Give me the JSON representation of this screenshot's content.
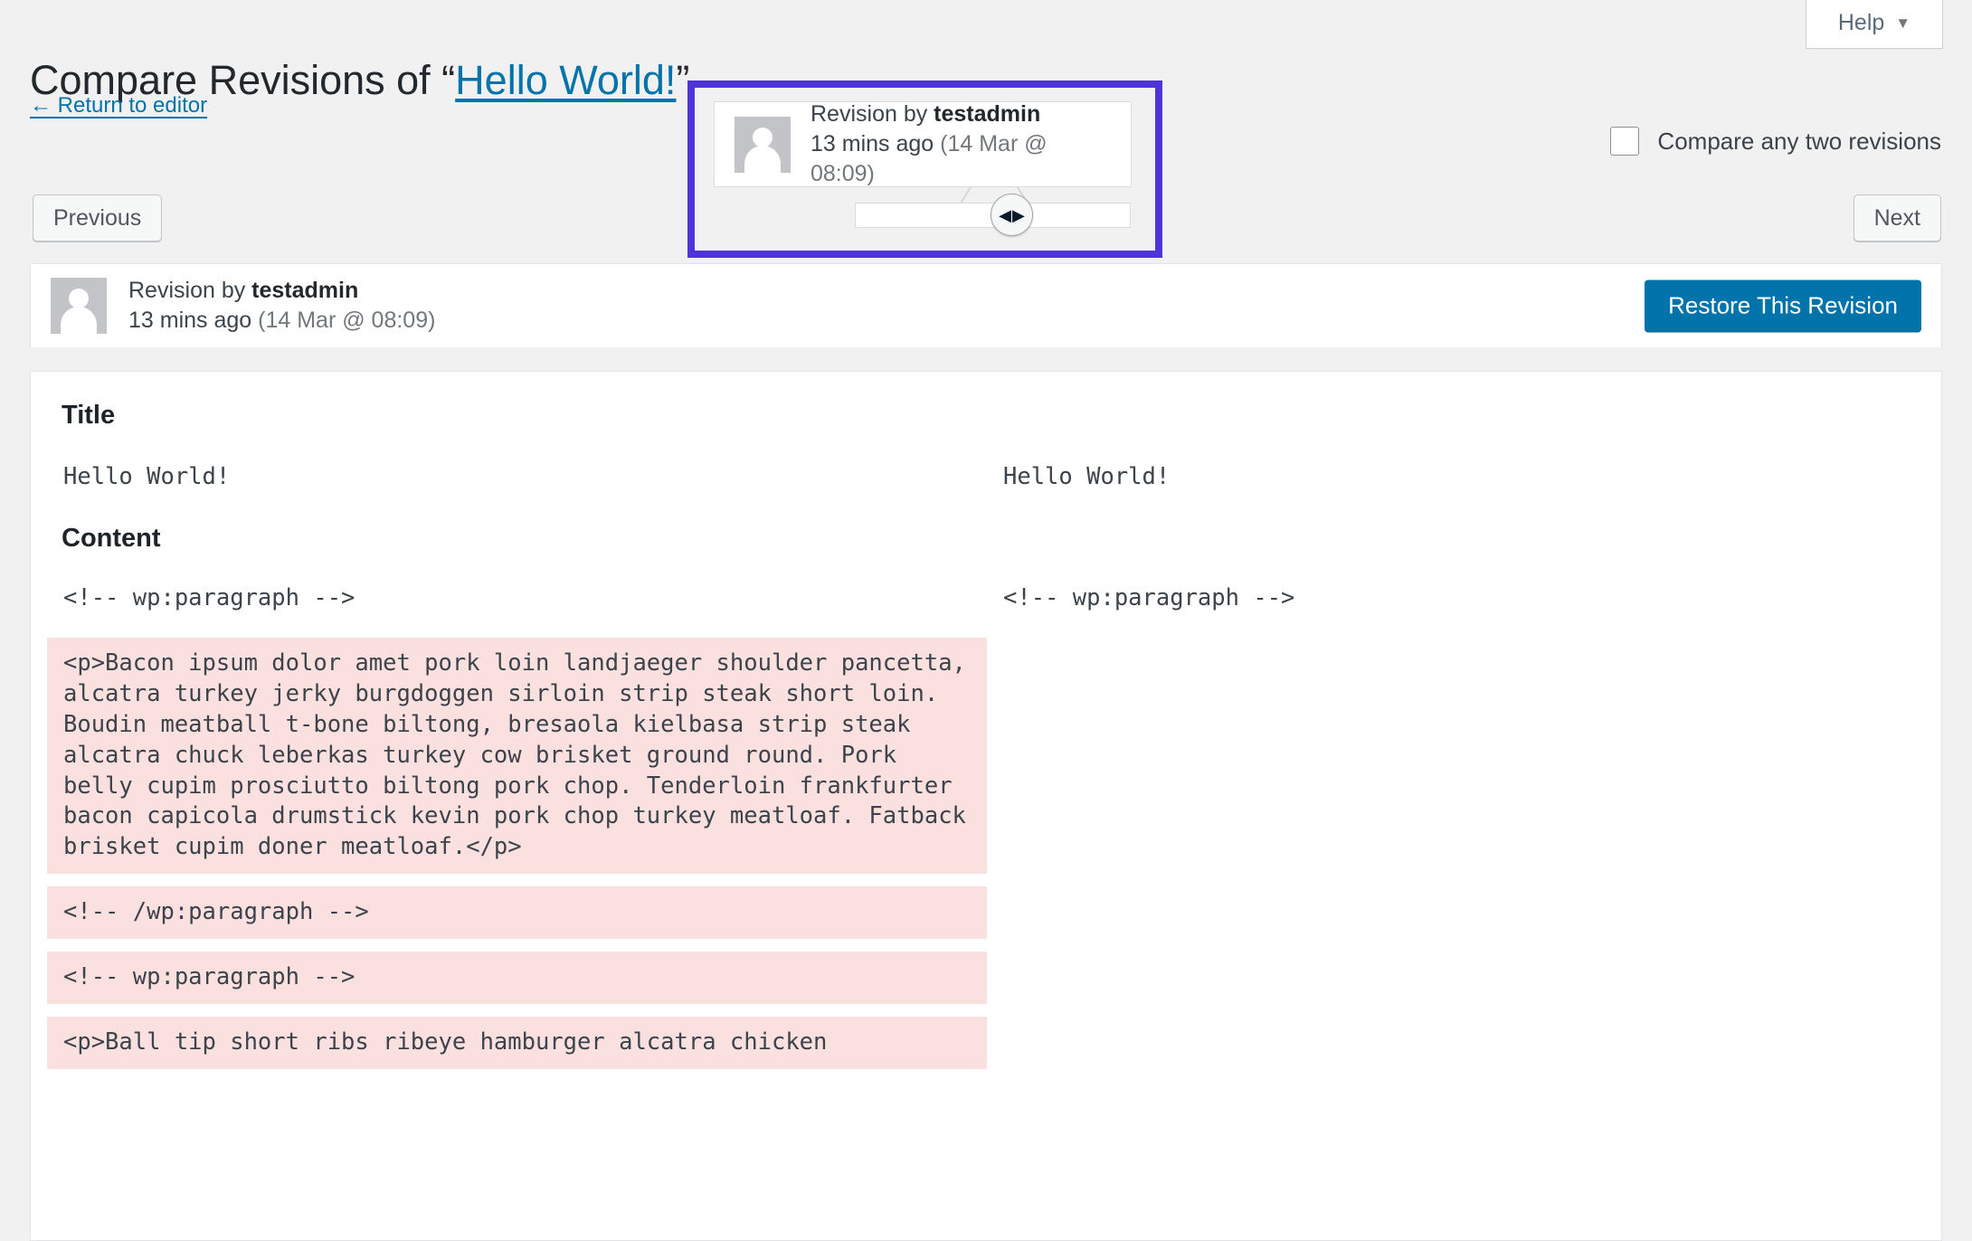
{
  "help": {
    "label": "Help",
    "caret": "▼",
    "icon": "chevron-down-icon"
  },
  "header": {
    "title_prefix": "Compare Revisions of “",
    "title_link": "Hello World!",
    "title_suffix": "”",
    "return_link": "← Return to editor"
  },
  "controls": {
    "previous": "Previous",
    "next": "Next",
    "compare_any_two": "Compare any two revisions",
    "compare_checked": false
  },
  "tooltip": {
    "revision_by_prefix": "Revision by ",
    "author": "testadmin",
    "relative_time": "13 mins ago",
    "absolute_time": " (14 Mar @ 08:09)",
    "avatar": "user-avatar-placeholder",
    "slider_handle_icon": "left-right-arrows-icon"
  },
  "revision_bar": {
    "revision_by_prefix": "Revision by ",
    "author": "testadmin",
    "relative_time": "13 mins ago",
    "absolute_time": " (14 Mar @ 08:09)",
    "restore_label": "Restore This Revision"
  },
  "diff": {
    "title_heading": "Title",
    "content_heading": "Content",
    "title_rows": [
      {
        "left": "Hello World!",
        "right": "Hello World!",
        "left_state": "blank",
        "right_state": "blank"
      }
    ],
    "content_rows": [
      {
        "left": "<!-- wp:paragraph -->",
        "right": "<!-- wp:paragraph -->",
        "left_state": "blank",
        "right_state": "blank"
      },
      {
        "left": "<p>Bacon ipsum dolor amet pork loin landjaeger shoulder pancetta, alcatra turkey jerky burgdoggen sirloin strip steak short loin. Boudin meatball t-bone biltong, bresaola kielbasa strip steak alcatra chuck leberkas turkey cow brisket ground round. Pork belly cupim prosciutto biltong pork chop. Tenderloin frankfurter bacon capicola drumstick kevin pork chop turkey meatloaf. Fatback brisket cupim doner meatloaf.</p>",
        "right": "",
        "left_state": "del",
        "right_state": "blank"
      },
      {
        "left": "<!-- /wp:paragraph -->",
        "right": "",
        "left_state": "del",
        "right_state": "blank"
      },
      {
        "left": "<!-- wp:paragraph -->",
        "right": "",
        "left_state": "del",
        "right_state": "blank"
      },
      {
        "left": "<p>Ball tip short ribs ribeye hamburger alcatra chicken",
        "right": "",
        "left_state": "del",
        "right_state": "blank"
      }
    ]
  },
  "colors": {
    "accent_blue": "#0073aa",
    "focus_purple": "#4e33d6",
    "diff_delete_bg": "#fbe0e0",
    "page_bg": "#f1f1f1"
  }
}
